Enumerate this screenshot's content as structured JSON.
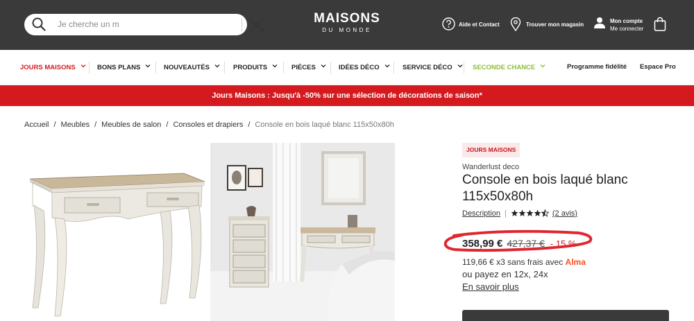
{
  "header": {
    "search_placeholder": "Je cherche un m",
    "logo_line1": "MAISONS",
    "logo_line2": "DU MONDE",
    "help_label": "Aide et Contact",
    "store_label": "Trouver mon magasin",
    "account_label": "Mon compte",
    "account_sub": "Me connecter"
  },
  "nav": {
    "items": [
      {
        "label": "JOURS MAISONS",
        "color": "#d41a1f"
      },
      {
        "label": "BONS PLANS"
      },
      {
        "label": "NOUVEAUTÉS"
      },
      {
        "label": "PRODUITS"
      },
      {
        "label": "PIÈCES"
      },
      {
        "label": "IDÉES DÉCO"
      },
      {
        "label": "SERVICE DÉCO"
      },
      {
        "label": "SECONDE CHANCE",
        "color": "#8dbd2f"
      }
    ],
    "fidelity": "Programme fidélité",
    "pro": "Espace Pro"
  },
  "promo": {
    "text": "Jours Maisons : Jusqu'à -50% sur une sélection de décorations de saison*"
  },
  "breadcrumb": {
    "items": [
      "Accueil",
      "Meubles",
      "Meubles de salon",
      "Consoles et drapiers"
    ],
    "current": "Console en bois laqué blanc 115x50x80h"
  },
  "product": {
    "badge": "JOURS MAISONS",
    "brand": "Wanderlust deco",
    "title": "Console en bois laqué blanc 115x50x80h",
    "description_link": "Description",
    "rating": 4.5,
    "reviews": "(2 avis)",
    "price_now": "358,99 €",
    "price_old": "427,37 €",
    "discount": "- 15 %",
    "alma_text": "119,66 € x3 sans frais avec",
    "alma_brand": "Alma",
    "pay_more": "ou payez en 12x, 24x",
    "learn_more": "En savoir plus"
  },
  "colors": {
    "header_bg": "#3a3a3a",
    "promo_bg": "#d41a1f",
    "accent_red": "#c8161d",
    "annotation_red": "#e0262f",
    "alma": "#fa5022"
  }
}
